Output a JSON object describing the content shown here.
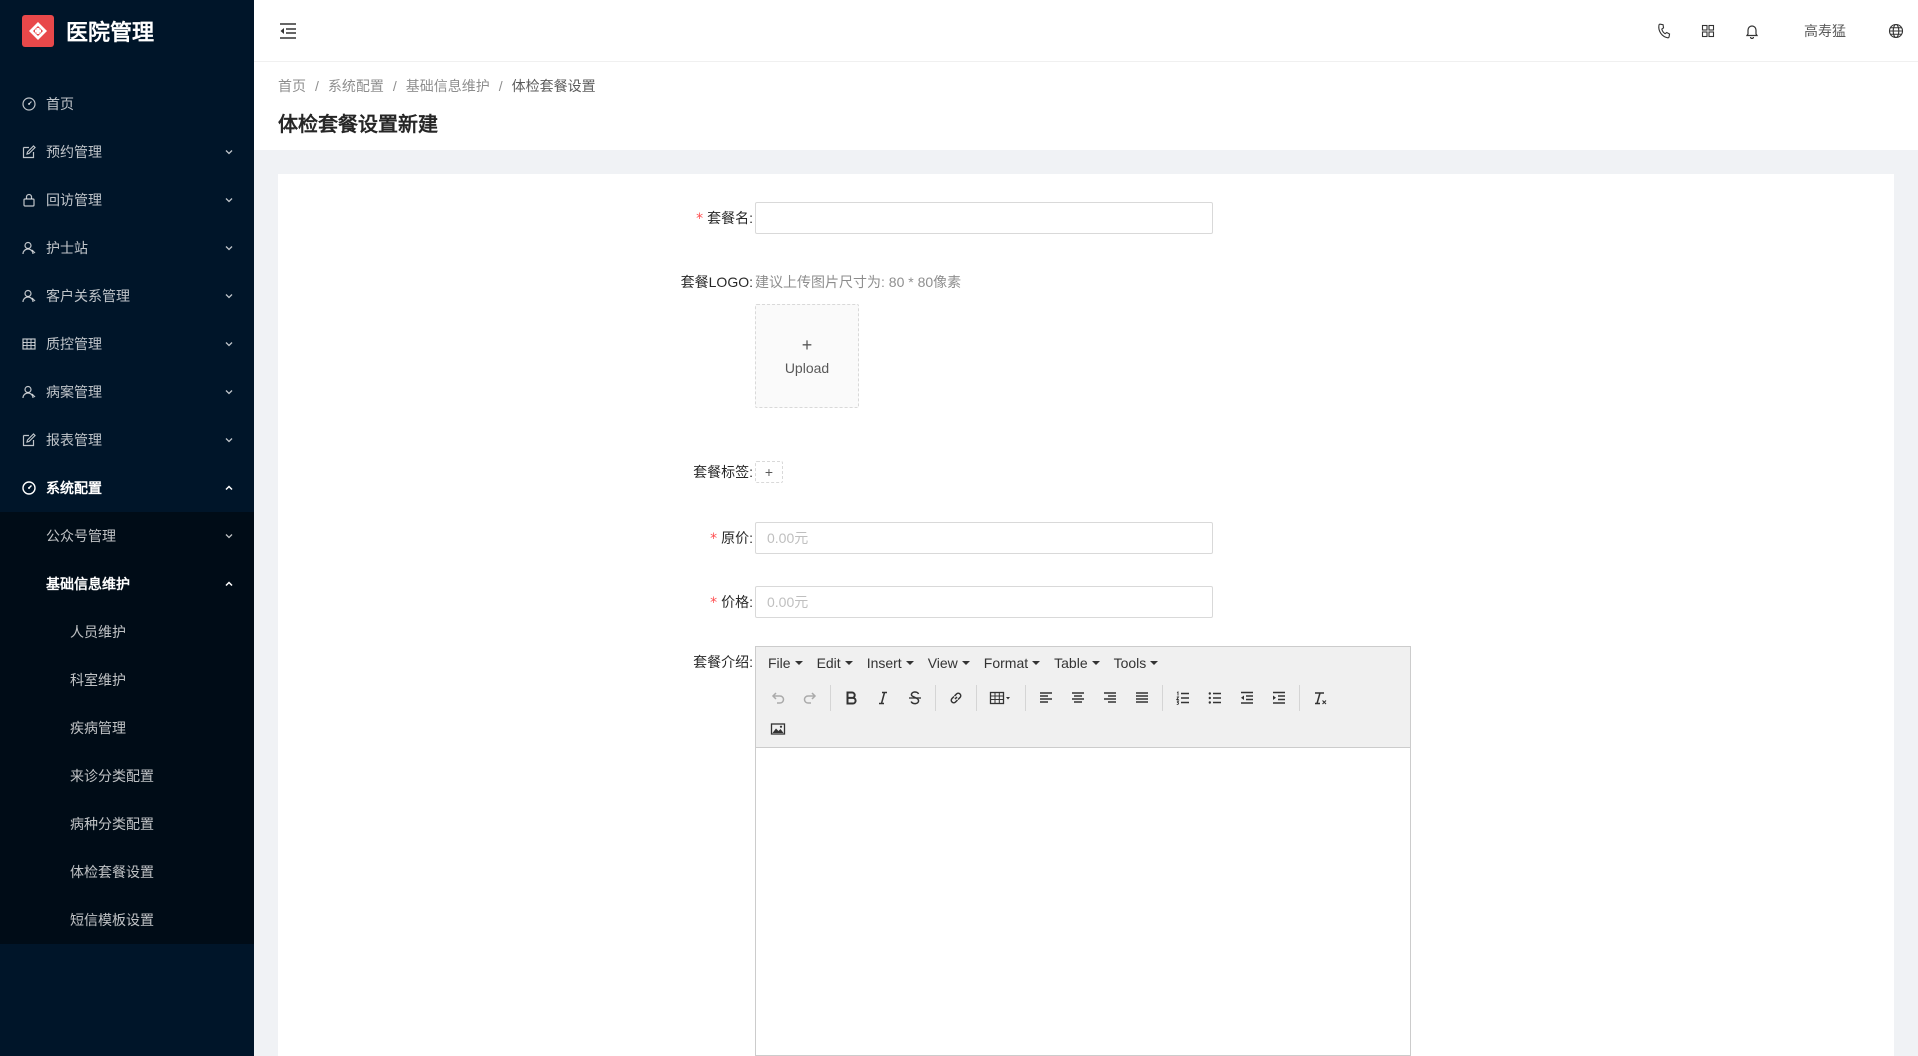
{
  "app": {
    "title": "医院管理"
  },
  "sidebar": {
    "items": [
      {
        "label": "首页",
        "icon": "dashboard-icon"
      },
      {
        "label": "预约管理",
        "icon": "edit-icon"
      },
      {
        "label": "回访管理",
        "icon": "lock-icon"
      },
      {
        "label": "护士站",
        "icon": "user-icon"
      },
      {
        "label": "客户关系管理",
        "icon": "user-icon"
      },
      {
        "label": "质控管理",
        "icon": "table-icon"
      },
      {
        "label": "病案管理",
        "icon": "user-icon"
      },
      {
        "label": "报表管理",
        "icon": "edit-icon"
      },
      {
        "label": "系统配置",
        "icon": "dashboard-icon"
      }
    ],
    "system_sub": {
      "wechat": "公众号管理",
      "basic_info": "基础信息维护",
      "basic_children": [
        "人员维护",
        "科室维护",
        "疾病管理",
        "来诊分类配置",
        "病种分类配置",
        "体检套餐设置",
        "短信模板设置"
      ]
    }
  },
  "header": {
    "username": "高寿猛"
  },
  "breadcrumb": [
    "首页",
    "系统配置",
    "基础信息维护",
    "体检套餐设置"
  ],
  "page": {
    "title": "体检套餐设置新建"
  },
  "form": {
    "name": {
      "label": "套餐名",
      "value": ""
    },
    "logo": {
      "label": "套餐LOGO",
      "hint": "建议上传图片尺寸为: 80 * 80像素",
      "upload_text": "Upload"
    },
    "tags": {
      "label": "套餐标签"
    },
    "original_price": {
      "label": "原价",
      "placeholder": "0.00元"
    },
    "price": {
      "label": "价格",
      "placeholder": "0.00元"
    },
    "intro": {
      "label": "套餐介绍"
    }
  },
  "editor": {
    "menus": [
      "File",
      "Edit",
      "Insert",
      "View",
      "Format",
      "Table",
      "Tools"
    ]
  }
}
